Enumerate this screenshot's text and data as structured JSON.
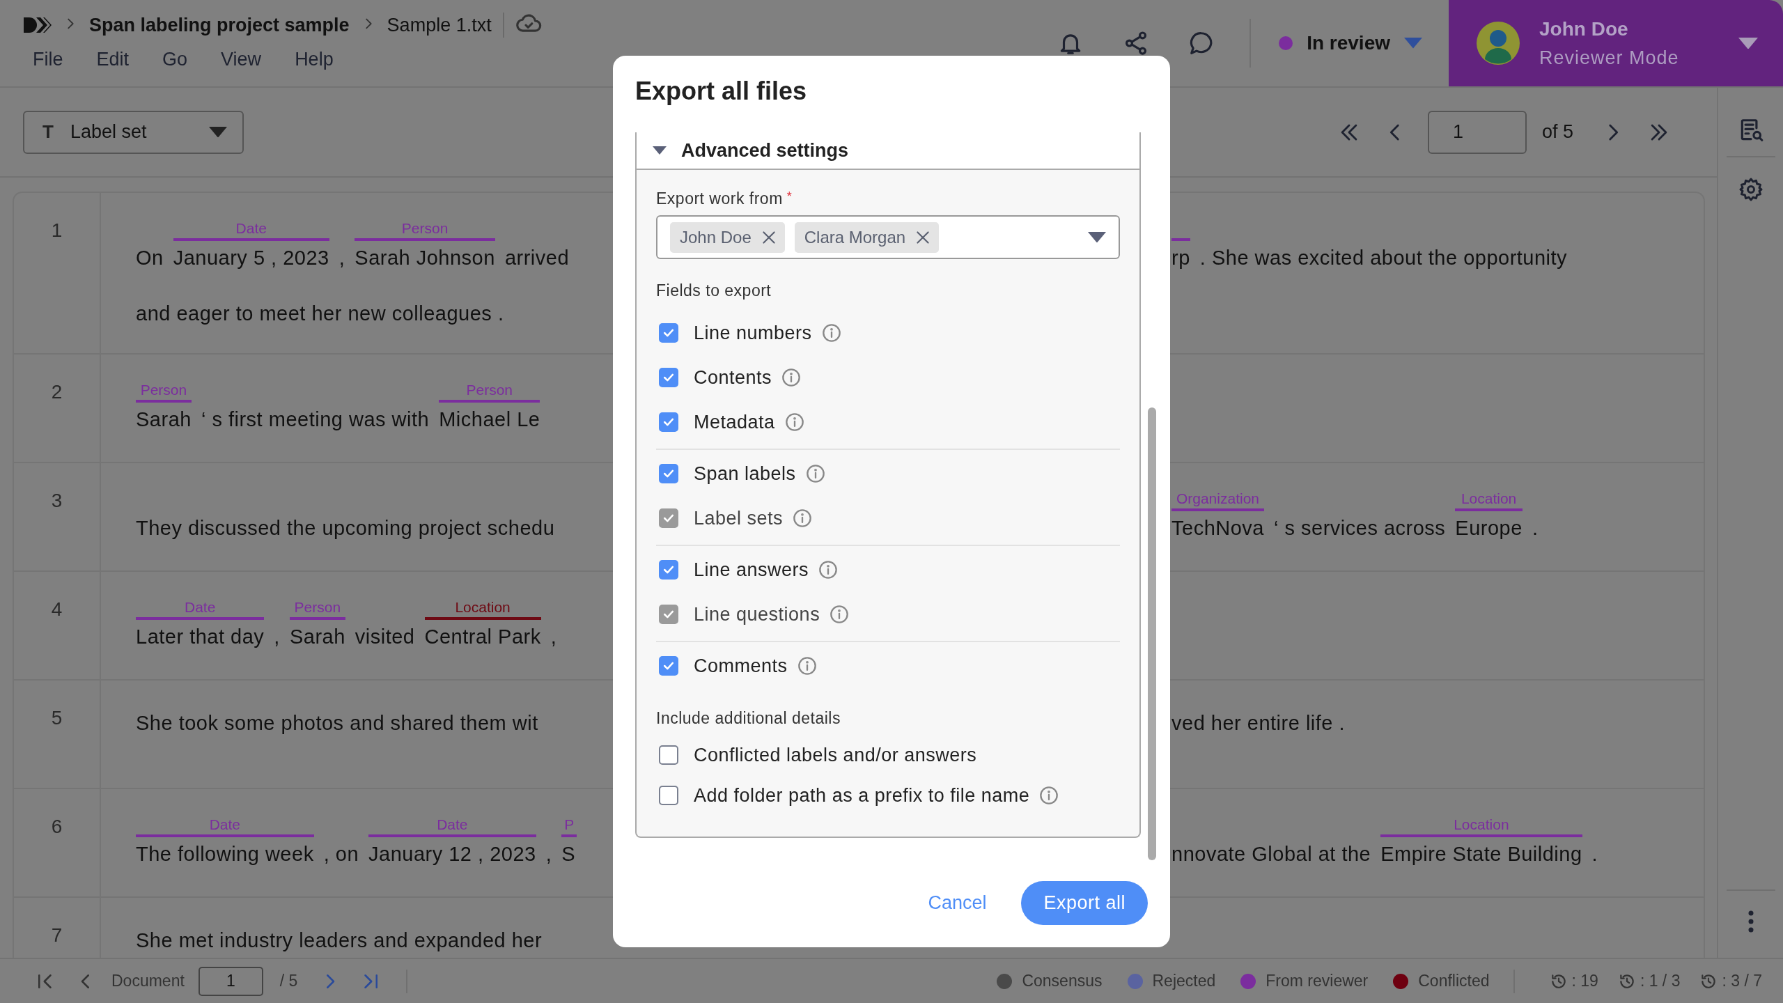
{
  "header": {
    "breadcrumb": [
      "Span labeling project sample",
      "Sample 1.txt"
    ],
    "menu": [
      "File",
      "Edit",
      "Go",
      "View",
      "Help"
    ],
    "status": "In review",
    "user": {
      "name": "John Doe",
      "role": "Reviewer Mode"
    }
  },
  "toolbar": {
    "label_set": {
      "icon": "T",
      "label": "Label set"
    },
    "page": "1",
    "page_total": "of 5"
  },
  "rows": [
    {
      "number": "1",
      "lines": [
        {
          "left": [
            {
              "text": "On"
            },
            {
              "text": "January 5 , 2023",
              "label": "Date",
              "color": "#7b2d9e"
            },
            {
              "text": ","
            },
            {
              "text": "Sarah Johnson",
              "label": "Person",
              "color": "#7b2d9e"
            },
            {
              "text": "arrived"
            }
          ],
          "right": [
            {
              "text": "rp",
              "color": "#7b2d9e"
            },
            {
              "text": ". She was excited about the opportunity"
            }
          ]
        },
        {
          "left": [
            {
              "text": "and eager to meet her new colleagues ."
            }
          ]
        }
      ]
    },
    {
      "number": "2",
      "lines": [
        {
          "left": [
            {
              "text": "Sarah",
              "label": "Person",
              "color": "#7b2d9e"
            },
            {
              "text": "‘ s first meeting was with"
            },
            {
              "text": "Michael Le",
              "label": "Person",
              "color": "#7b2d9e"
            }
          ]
        }
      ]
    },
    {
      "number": "3",
      "lines": [
        {
          "left": [
            {
              "text": "They discussed the upcoming project schedu"
            }
          ],
          "right": [
            {
              "text": "TechNova",
              "label": "Organization",
              "color": "#7b2d9e"
            },
            {
              "text": "‘ s services across"
            },
            {
              "text": "Europe",
              "label": "Location",
              "color": "#7b2d9e"
            },
            {
              "text": "."
            }
          ]
        }
      ]
    },
    {
      "number": "4",
      "lines": [
        {
          "left": [
            {
              "text": "Later that day",
              "label": "Date",
              "color": "#7b2d9e"
            },
            {
              "text": ","
            },
            {
              "text": "Sarah",
              "label": "Person",
              "color": "#7b2d9e"
            },
            {
              "text": "visited"
            },
            {
              "text": "Central Park",
              "label": "Location",
              "color": "#6e0a14"
            },
            {
              "text": ","
            }
          ]
        }
      ]
    },
    {
      "number": "5",
      "lines": [
        {
          "left": [
            {
              "text": "She took some photos and shared them wit"
            }
          ],
          "right": [
            {
              "text": "ved her entire life ."
            }
          ]
        }
      ]
    },
    {
      "number": "6",
      "lines": [
        {
          "left": [
            {
              "text": "The following week",
              "label": "Date",
              "color": "#7b2d9e"
            },
            {
              "text": ", on"
            },
            {
              "text": "January 12 , 2023",
              "label": "Date",
              "color": "#7b2d9e"
            },
            {
              "text": ","
            },
            {
              "text": "S",
              "label": "P",
              "color": "#7b2d9e"
            }
          ],
          "right": [
            {
              "text": "nnovate Global at the"
            },
            {
              "text": "Empire State Building",
              "label": "Location",
              "color": "#7b2d9e"
            },
            {
              "text": "."
            }
          ]
        }
      ]
    },
    {
      "number": "7",
      "lines": [
        {
          "left": [
            {
              "text": "She met industry leaders and expanded her"
            }
          ]
        }
      ]
    }
  ],
  "footer": {
    "document_label": "Document",
    "document_value": "1",
    "document_total": "/ 5",
    "legend": [
      {
        "label": "Consensus",
        "color": "#4a4a4a"
      },
      {
        "label": "Rejected",
        "color": "#5a63a0"
      },
      {
        "label": "From reviewer",
        "color": "#7b2d9e"
      },
      {
        "label": "Conflicted",
        "color": "#6e0010"
      }
    ],
    "stats": [
      ": 19",
      ": 1 / 3",
      ": 3 / 7"
    ]
  },
  "dialog": {
    "title": "Export all files",
    "section": {
      "title": "Advanced settings",
      "expanded": true
    },
    "export_from": {
      "label": "Export work from",
      "required_mark": "*",
      "chips": [
        "John Doe",
        "Clara Morgan"
      ]
    },
    "fields_title": "Fields to export",
    "field_groups": [
      [
        {
          "label": "Line numbers",
          "checked": true,
          "disabled": false,
          "info": true
        },
        {
          "label": "Contents",
          "checked": true,
          "disabled": false,
          "info": true
        },
        {
          "label": "Metadata",
          "checked": true,
          "disabled": false,
          "info": true
        }
      ],
      [
        {
          "label": "Span labels",
          "checked": true,
          "disabled": false,
          "info": true
        },
        {
          "label": "Label sets",
          "checked": true,
          "disabled": true,
          "info": true
        }
      ],
      [
        {
          "label": "Line answers",
          "checked": true,
          "disabled": false,
          "info": true
        },
        {
          "label": "Line questions",
          "checked": true,
          "disabled": true,
          "info": true
        }
      ],
      [
        {
          "label": "Comments",
          "checked": true,
          "disabled": false,
          "info": true
        }
      ]
    ],
    "details_title": "Include additional details",
    "details": [
      {
        "label": "Conflicted labels and/or answers",
        "checked": false,
        "disabled": false,
        "info": false
      },
      {
        "label": "Add folder path as a prefix to file name",
        "checked": false,
        "disabled": false,
        "info": true
      }
    ],
    "cancel": "Cancel",
    "confirm": "Export all"
  }
}
